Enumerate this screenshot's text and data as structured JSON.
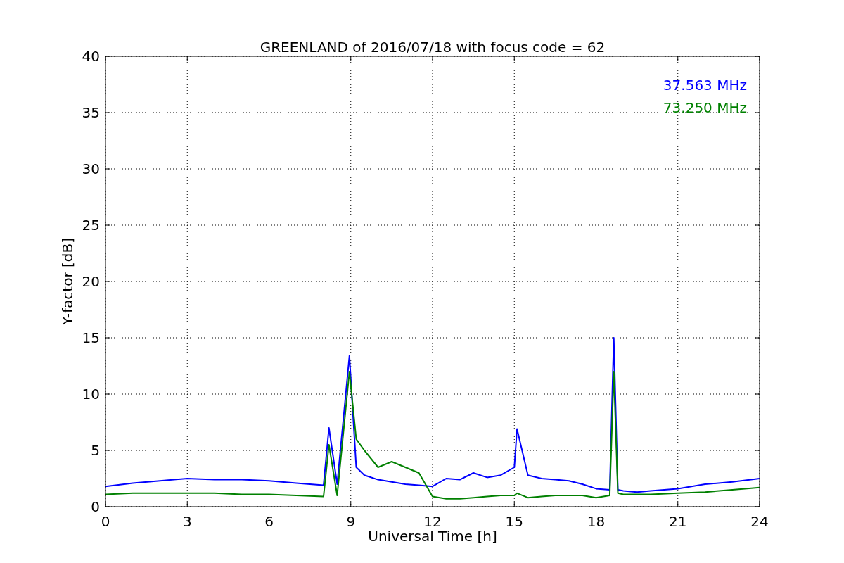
{
  "chart_data": {
    "type": "line",
    "title": "GREENLAND of 2016/07/18 with focus code = 62",
    "xlabel": "Universal Time [h]",
    "ylabel": "Y-factor [dB]",
    "x": [
      0,
      1,
      2,
      3,
      4,
      5,
      6,
      7,
      8,
      8.2,
      8.5,
      8.95,
      9.2,
      9.5,
      10,
      10.5,
      11,
      11.5,
      12,
      12.5,
      13,
      13.5,
      14,
      14.5,
      15,
      15.1,
      15.5,
      16,
      16.5,
      17,
      17.5,
      18,
      18.5,
      18.65,
      18.8,
      19,
      19.5,
      20,
      21,
      22,
      23,
      24
    ],
    "series": [
      {
        "name": "37.563 MHz",
        "color": "#0000ff",
        "values": [
          1.8,
          2.1,
          2.3,
          2.5,
          2.4,
          2.4,
          2.3,
          2.1,
          1.9,
          7.0,
          2.0,
          13.4,
          3.5,
          2.8,
          2.4,
          2.2,
          2.0,
          1.9,
          1.8,
          2.5,
          2.4,
          3.0,
          2.6,
          2.8,
          3.5,
          6.9,
          2.8,
          2.5,
          2.4,
          2.3,
          2.0,
          1.6,
          1.5,
          15.0,
          1.5,
          1.4,
          1.3,
          1.4,
          1.6,
          2.0,
          2.2,
          2.5
        ]
      },
      {
        "name": "73.250 MHz",
        "color": "#008000",
        "values": [
          1.1,
          1.2,
          1.2,
          1.2,
          1.2,
          1.1,
          1.1,
          1.0,
          0.9,
          5.5,
          1.0,
          12.0,
          6.0,
          5.0,
          3.5,
          4.0,
          3.5,
          3.0,
          0.9,
          0.7,
          0.7,
          0.8,
          0.9,
          1.0,
          1.0,
          1.2,
          0.8,
          0.9,
          1.0,
          1.0,
          1.0,
          0.8,
          1.0,
          12.0,
          1.2,
          1.1,
          1.1,
          1.1,
          1.2,
          1.3,
          1.5,
          1.7
        ]
      }
    ],
    "xlim": [
      0,
      24
    ],
    "ylim": [
      0,
      40
    ],
    "xticks": [
      0,
      3,
      6,
      9,
      12,
      15,
      18,
      21,
      24
    ],
    "yticks": [
      0,
      5,
      10,
      15,
      20,
      25,
      30,
      35,
      40
    ],
    "grid": true
  }
}
